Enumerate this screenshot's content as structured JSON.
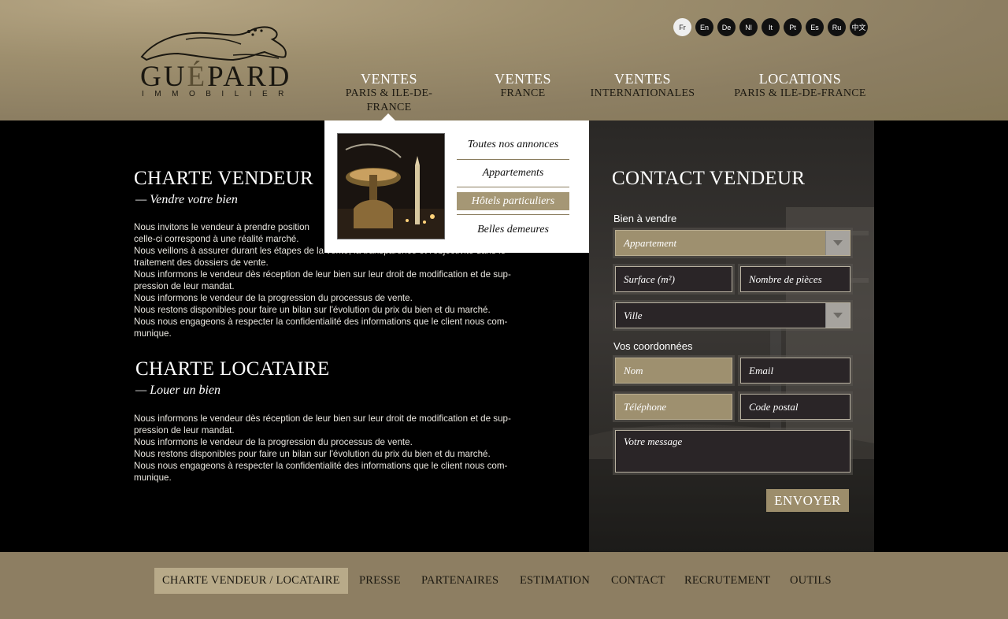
{
  "logo": {
    "word_start": "GU",
    "word_accent": "É",
    "word_end": "PARD",
    "sub": "IMMOBILIER"
  },
  "languages": [
    "Fr",
    "En",
    "De",
    "Nl",
    "It",
    "Pt",
    "Es",
    "Ru",
    "中文"
  ],
  "active_language": "Fr",
  "nav": [
    {
      "line1": "VENTES",
      "line2": "PARIS & ILE-DE-FRANCE"
    },
    {
      "line1": "VENTES",
      "line2": "FRANCE"
    },
    {
      "line1": "VENTES",
      "line2": "INTERNATIONALES"
    },
    {
      "line1": "LOCATIONS",
      "line2": "PARIS & ILE-DE-FRANCE"
    }
  ],
  "dropdown": {
    "links": [
      "Toutes nos annonces",
      "Appartements",
      "Hôtels particuliers",
      "Belles demeures"
    ],
    "active_index": 2
  },
  "vendeur": {
    "title": "CHARTE VENDEUR",
    "subtitle": "— Vendre votre bien",
    "lines": [
      "Nous invitons le vendeur à prendre position",
      "celle-ci correspond à une réalité marché.",
      "Nous veillons à assurer durant les étapes de la vente, la transparence et l'objectivité dans le",
      "traitement des dossiers de vente.",
      "Nous informons le vendeur dès réception de leur bien sur leur droit de modification et de sup-",
      "pression de leur mandat.",
      "Nous informons le vendeur de la progression du processus de vente.",
      "Nous restons disponibles pour faire un bilan sur l'évolution du prix du bien et du marché.",
      "Nous nous engageons à respecter la confidentialité des informations que le client nous com-",
      "munique."
    ]
  },
  "locataire": {
    "title": "CHARTE LOCATAIRE",
    "subtitle": "— Louer un bien",
    "lines": [
      "Nous informons le vendeur dès réception de leur bien sur leur droit de modification et de sup-",
      "pression de leur mandat.",
      "Nous informons le vendeur de la progression du processus de vente.",
      "Nous restons disponibles pour faire un bilan sur l'évolution du prix du bien et du marché.",
      "Nous nous engageons à respecter la confidentialité des informations que le client nous com-",
      "munique."
    ]
  },
  "contact": {
    "title": "CONTACT VENDEUR",
    "label_bien": "Bien à vendre",
    "type_value": "Appartement",
    "surface_placeholder": "Surface (m²)",
    "pieces_placeholder": "Nombre de pièces",
    "ville_value": "Ville",
    "label_coord": "Vos coordonnées",
    "nom_placeholder": "Nom",
    "email_placeholder": "Email",
    "tel_placeholder": "Téléphone",
    "cp_placeholder": "Code postal",
    "message_placeholder": "Votre message",
    "send_label": "ENVOYER"
  },
  "footer": [
    "CHARTE VENDEUR / LOCATAIRE",
    "PRESSE",
    "PARTENAIRES",
    "ESTIMATION",
    "CONTACT",
    "RECRUTEMENT",
    "OUTILS"
  ],
  "colors": {
    "header_gold": "#9e8f6e",
    "accent_gold": "#a59775",
    "footer": "#8d7e62"
  }
}
